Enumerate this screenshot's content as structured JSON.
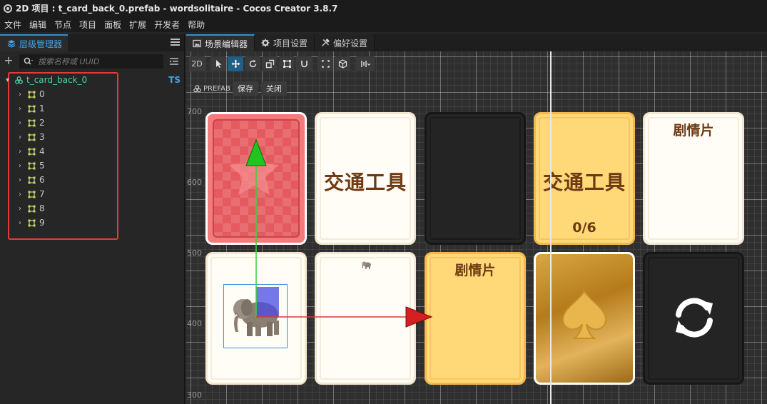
{
  "window": {
    "title": "2D 项目 : t_card_back_0.prefab - wordsolitaire - Cocos Creator 3.8.7"
  },
  "menu": [
    {
      "label": "文件"
    },
    {
      "label": "编辑"
    },
    {
      "label": "节点"
    },
    {
      "label": "项目"
    },
    {
      "label": "面板"
    },
    {
      "label": "扩展"
    },
    {
      "label": "开发者"
    },
    {
      "label": "帮助"
    }
  ],
  "hierarchy": {
    "tab_label": "层级管理器",
    "search_placeholder": "搜索名称或 UUID",
    "root": {
      "label": "t_card_back_0",
      "badge": "TS"
    },
    "children": [
      {
        "label": "0"
      },
      {
        "label": "1"
      },
      {
        "label": "2"
      },
      {
        "label": "3"
      },
      {
        "label": "4"
      },
      {
        "label": "5"
      },
      {
        "label": "6"
      },
      {
        "label": "7"
      },
      {
        "label": "8"
      },
      {
        "label": "9"
      }
    ]
  },
  "scene": {
    "tabs": [
      {
        "label": "场景编辑器"
      },
      {
        "label": "项目设置"
      },
      {
        "label": "偏好设置"
      }
    ],
    "toolbar": {
      "mode_2d": "2D"
    },
    "prefab_bar": {
      "label": "PREFAB",
      "save": "保存",
      "close": "关闭"
    },
    "ruler": [
      {
        "label": "700"
      },
      {
        "label": "600"
      },
      {
        "label": "500"
      },
      {
        "label": "400"
      },
      {
        "label": "300"
      }
    ],
    "cards": {
      "c2_text": "交通工具",
      "c4_text": "交通工具",
      "c4_count": "0/6",
      "c5_title": "剧情片",
      "c8_title": "剧情片"
    }
  },
  "colors": {
    "accent": "#2f8fd1",
    "highlight": "#e63a3a",
    "card_text": "#6d3a14"
  }
}
